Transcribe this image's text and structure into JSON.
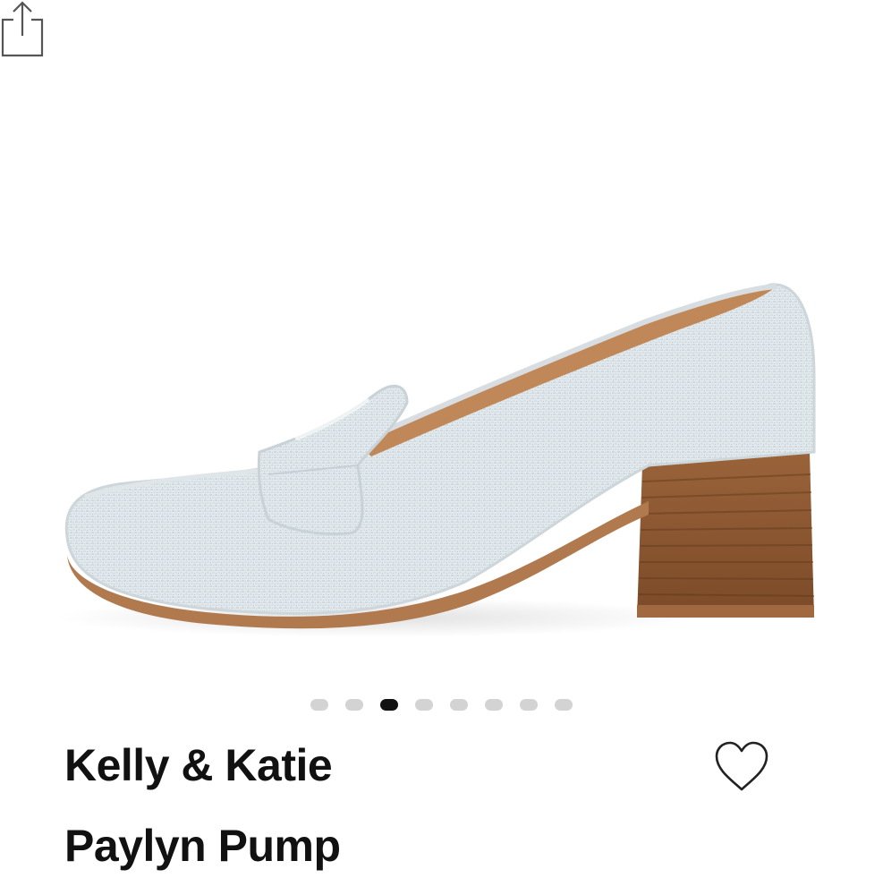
{
  "product": {
    "brand": "Kelly & Katie",
    "name": "Paylyn Pump"
  },
  "gallery": {
    "image_count": 8,
    "active_index": 2
  },
  "icons": {
    "share": "share-icon",
    "favorite": "heart-outline-icon"
  },
  "colors": {
    "text": "#111111",
    "dot_active": "#111111",
    "dot_inactive": "#d3d3d3"
  }
}
